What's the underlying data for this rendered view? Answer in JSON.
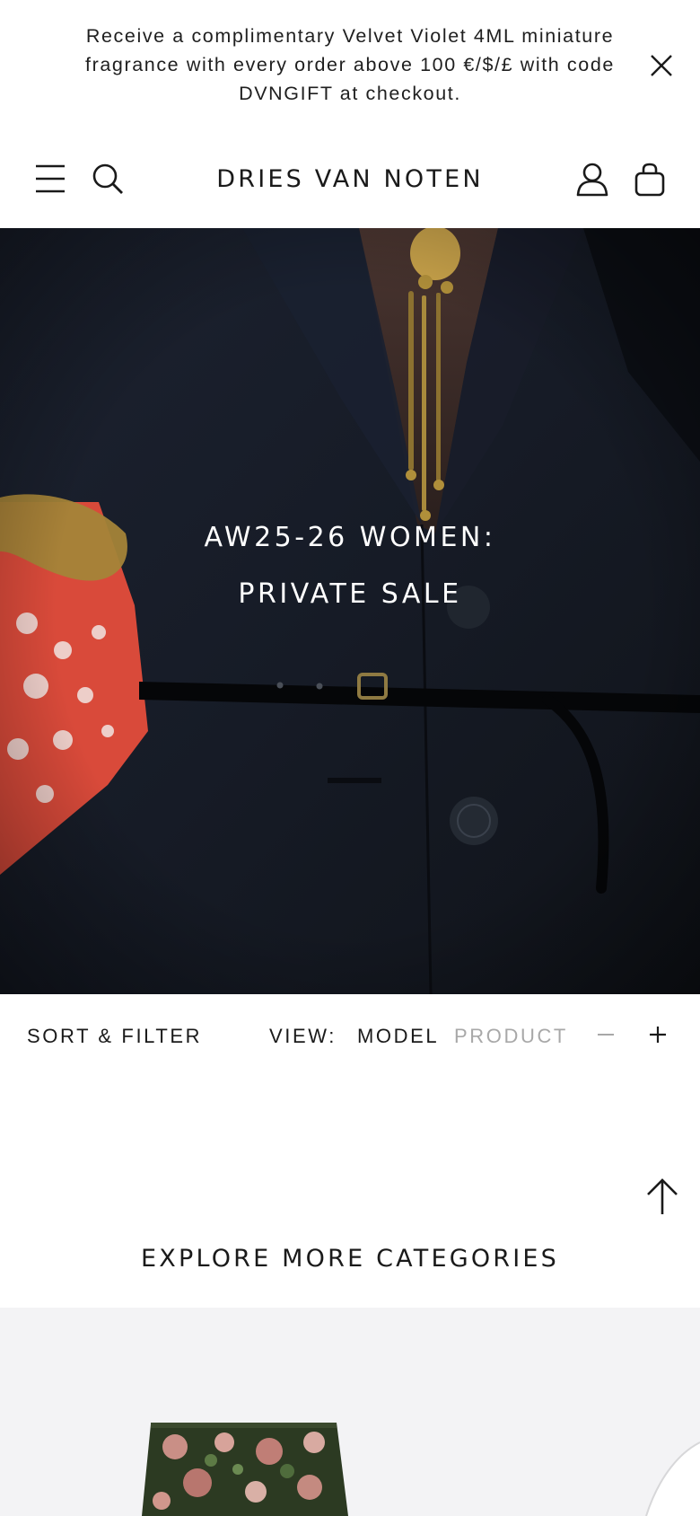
{
  "announcement": {
    "text": "Receive a complimentary Velvet Violet 4ML miniature fragrance with every order above 100 €/$/£ with code DVNGIFT at checkout.",
    "close_icon": "close-icon"
  },
  "header": {
    "brand": "DRIES VAN NOTEN",
    "icons": [
      "menu-icon",
      "search-icon",
      "account-icon",
      "bag-icon"
    ]
  },
  "hero": {
    "title_line1": "AW25-26 WOMEN:",
    "title_line2": "PRIVATE SALE"
  },
  "toolbar": {
    "sort_filter": "SORT & FILTER",
    "view_label": "VIEW:",
    "view_model": "MODEL",
    "view_product": "PRODUCT",
    "zoom_out_icon": "minus-icon",
    "zoom_in_icon": "plus-icon"
  },
  "back_to_top_icon": "arrow-up-icon",
  "explore": {
    "title": "EXPLORE MORE CATEGORIES"
  },
  "colors": {
    "text": "#1a1a1a",
    "muted": "#a8a8a8",
    "strip_bg": "#f3f3f5",
    "hero_bg": "#141820"
  }
}
